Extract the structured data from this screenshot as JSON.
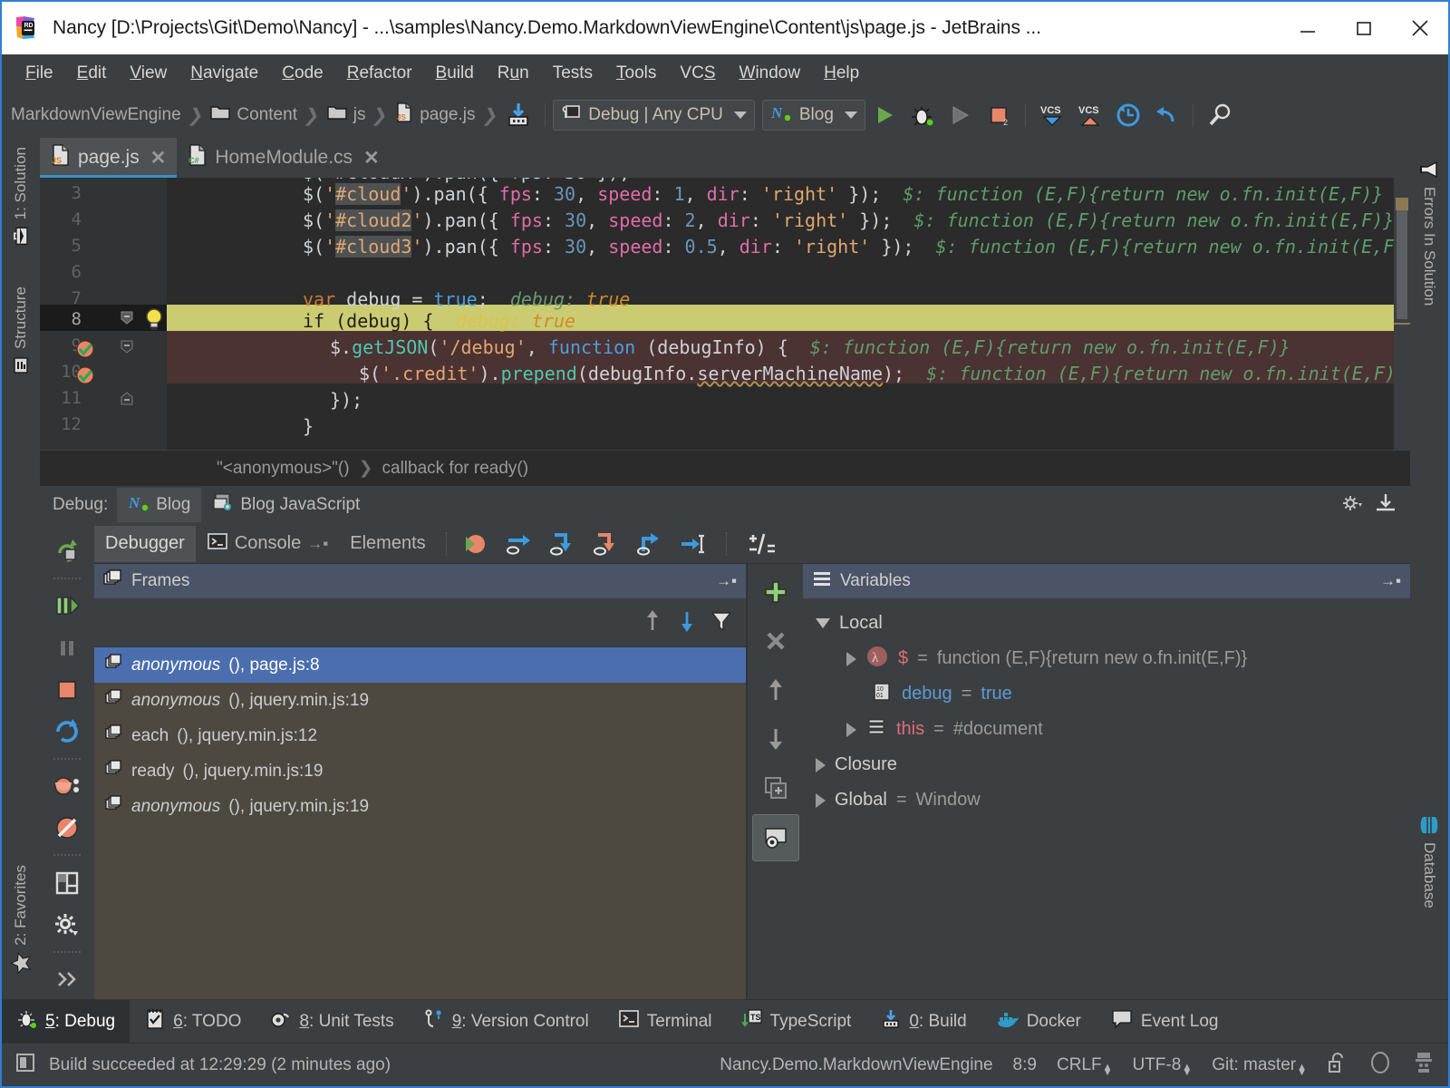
{
  "window": {
    "title": "Nancy [D:\\Projects\\Git\\Demo\\Nancy] - ...\\samples\\Nancy.Demo.MarkdownViewEngine\\Content\\js\\page.js - JetBrains ...",
    "minimize_label": "Minimize",
    "maximize_label": "Maximize",
    "close_label": "Close"
  },
  "menu": [
    {
      "label": "File",
      "mnemonic": "F"
    },
    {
      "label": "Edit",
      "mnemonic": "E"
    },
    {
      "label": "View",
      "mnemonic": "V"
    },
    {
      "label": "Navigate",
      "mnemonic": "N"
    },
    {
      "label": "Code",
      "mnemonic": "C"
    },
    {
      "label": "Refactor",
      "mnemonic": "R"
    },
    {
      "label": "Build",
      "mnemonic": "B"
    },
    {
      "label": "Run",
      "mnemonic": "u"
    },
    {
      "label": "Tests",
      "mnemonic": ""
    },
    {
      "label": "Tools",
      "mnemonic": "T"
    },
    {
      "label": "VCS",
      "mnemonic": "S"
    },
    {
      "label": "Window",
      "mnemonic": "W"
    },
    {
      "label": "Help",
      "mnemonic": "H"
    }
  ],
  "toolbar": {
    "breadcrumbs": [
      {
        "label": "MarkdownViewEngine",
        "icon": "none"
      },
      {
        "label": "Content",
        "icon": "folder-icon"
      },
      {
        "label": "js",
        "icon": "folder-icon"
      },
      {
        "label": "page.js",
        "icon": "js-file-icon"
      }
    ],
    "build_icon": "build-icon",
    "config_combo": "Debug | Any CPU",
    "run_combo": "Blog",
    "run_button": "run-button",
    "debug_button": "debug-button",
    "coverage_button": "coverage-button",
    "stop_button": "stop-button",
    "vcs_update_label": "VCS",
    "vcs_commit_label": "VCS",
    "rollback_button": "rollback-button",
    "undo_button": "undo-button",
    "search_button": "search-everywhere-button"
  },
  "left_sidebar": [
    {
      "label": "1: Solution",
      "mnemonic": "1",
      "icon": "solution-icon"
    },
    {
      "label": "Structure",
      "mnemonic": "",
      "icon": "structure-icon"
    },
    {
      "label": "2: Favorites",
      "mnemonic": "2",
      "icon": "star-icon"
    }
  ],
  "right_sidebar": [
    {
      "label": "Errors In Solution",
      "icon": "flask-icon"
    },
    {
      "label": "Database",
      "icon": "database-icon"
    }
  ],
  "editor": {
    "tabs": [
      {
        "label": "page.js",
        "icon": "js-file-icon",
        "active": true,
        "close": "✕"
      },
      {
        "label": "HomeModule.cs",
        "icon": "cs-file-icon",
        "active": false,
        "close": "✕"
      }
    ],
    "line_numbers": [
      "3",
      "4",
      "5",
      "6",
      "7",
      "8",
      "9",
      "10",
      "11",
      "12"
    ],
    "current_line": "8",
    "lines": [
      {
        "num": "3",
        "tokens": [
          {
            "t": "$(",
            "c": "punc"
          },
          {
            "t": "'",
            "c": "str"
          },
          {
            "t": "#cloud",
            "c": "str sel"
          },
          {
            "t": "'",
            "c": "str"
          },
          {
            "t": ").",
            "c": "punc"
          },
          {
            "t": "pan",
            "c": "id"
          },
          {
            "t": "({ ",
            "c": "punc"
          },
          {
            "t": "fps",
            "c": "prop"
          },
          {
            "t": ": ",
            "c": "punc"
          },
          {
            "t": "30",
            "c": "num"
          },
          {
            "t": ", ",
            "c": "punc"
          },
          {
            "t": "speed",
            "c": "prop"
          },
          {
            "t": ": ",
            "c": "punc"
          },
          {
            "t": "1",
            "c": "num"
          },
          {
            "t": ", ",
            "c": "punc"
          },
          {
            "t": "dir",
            "c": "prop"
          },
          {
            "t": ": ",
            "c": "punc"
          },
          {
            "t": "'right'",
            "c": "str"
          },
          {
            "t": " });",
            "c": "punc"
          }
        ],
        "hint": "$: function (E,F){return new o.fn.init(E,F)}"
      },
      {
        "num": "4",
        "tokens": [
          {
            "t": "$(",
            "c": "punc"
          },
          {
            "t": "'",
            "c": "str"
          },
          {
            "t": "#cloud2",
            "c": "str sel"
          },
          {
            "t": "'",
            "c": "str"
          },
          {
            "t": ").",
            "c": "punc"
          },
          {
            "t": "pan",
            "c": "id"
          },
          {
            "t": "({ ",
            "c": "punc"
          },
          {
            "t": "fps",
            "c": "prop"
          },
          {
            "t": ": ",
            "c": "punc"
          },
          {
            "t": "30",
            "c": "num"
          },
          {
            "t": ", ",
            "c": "punc"
          },
          {
            "t": "speed",
            "c": "prop"
          },
          {
            "t": ": ",
            "c": "punc"
          },
          {
            "t": "2",
            "c": "num"
          },
          {
            "t": ", ",
            "c": "punc"
          },
          {
            "t": "dir",
            "c": "prop"
          },
          {
            "t": ": ",
            "c": "punc"
          },
          {
            "t": "'right'",
            "c": "str"
          },
          {
            "t": " });",
            "c": "punc"
          }
        ],
        "hint": "$: function (E,F){return new o.fn.init(E,F)}"
      },
      {
        "num": "5",
        "tokens": [
          {
            "t": "$(",
            "c": "punc"
          },
          {
            "t": "'",
            "c": "str"
          },
          {
            "t": "#cloud3",
            "c": "str sel"
          },
          {
            "t": "'",
            "c": "str"
          },
          {
            "t": ").",
            "c": "punc"
          },
          {
            "t": "pan",
            "c": "id"
          },
          {
            "t": "({ ",
            "c": "punc"
          },
          {
            "t": "fps",
            "c": "prop"
          },
          {
            "t": ": ",
            "c": "punc"
          },
          {
            "t": "30",
            "c": "num"
          },
          {
            "t": ", ",
            "c": "punc"
          },
          {
            "t": "speed",
            "c": "prop"
          },
          {
            "t": ": ",
            "c": "punc"
          },
          {
            "t": "0.5",
            "c": "num"
          },
          {
            "t": ", ",
            "c": "punc"
          },
          {
            "t": "dir",
            "c": "prop"
          },
          {
            "t": ": ",
            "c": "punc"
          },
          {
            "t": "'right'",
            "c": "str"
          },
          {
            "t": " });",
            "c": "punc"
          }
        ],
        "hint": "$: function (E,F){return new o.fn.init(E,F)}"
      },
      {
        "num": "6",
        "tokens": [],
        "hint": ""
      },
      {
        "num": "7",
        "tokens": [
          {
            "t": "var ",
            "c": "kw"
          },
          {
            "t": "debug",
            "c": "id"
          },
          {
            "t": " = ",
            "c": "punc"
          },
          {
            "t": "true",
            "c": "kw2"
          },
          {
            "t": ";",
            "c": "punc"
          }
        ],
        "hint": "",
        "inline_debug": {
          "name": "debug:",
          "value": "true",
          "style": "normal"
        }
      },
      {
        "num": "8",
        "tokens": [
          {
            "t": "if ",
            "c": "dark"
          },
          {
            "t": "(debug) {",
            "c": "dark"
          }
        ],
        "hint": "",
        "inline_debug": {
          "name": "debug:",
          "value": "true",
          "style": "highlight"
        }
      },
      {
        "num": "9",
        "tokens": [
          {
            "t": "$.",
            "c": "punc"
          },
          {
            "t": "getJSON",
            "c": "fnc"
          },
          {
            "t": "(",
            "c": "punc"
          },
          {
            "t": "'/debug'",
            "c": "str"
          },
          {
            "t": ", ",
            "c": "punc"
          },
          {
            "t": "function ",
            "c": "kw2"
          },
          {
            "t": "(debugInfo) {",
            "c": "punc"
          }
        ],
        "hint": "$: function (E,F){return new o.fn.init(E,F)}"
      },
      {
        "num": "10",
        "tokens": [
          {
            "t": "$(",
            "c": "punc"
          },
          {
            "t": "'.credit'",
            "c": "str"
          },
          {
            "t": ").",
            "c": "punc"
          },
          {
            "t": "prepend",
            "c": "fnc"
          },
          {
            "t": "(debugInfo.",
            "c": "punc"
          },
          {
            "t": "serverMachineName",
            "c": "wavy"
          },
          {
            "t": ");",
            "c": "punc"
          }
        ],
        "hint": "$: function (E,F){return new o.fn.init(E,F)}"
      },
      {
        "num": "11",
        "tokens": [
          {
            "t": "});",
            "c": "punc"
          }
        ],
        "hint": ""
      },
      {
        "num": "12",
        "tokens": [
          {
            "t": "}",
            "c": "punc"
          }
        ],
        "hint": ""
      }
    ],
    "breadcrumb": [
      "\"<anonymous>\"()",
      "callback for ready()"
    ],
    "gutter_icons": {
      "line8": "intention-bulb-icon",
      "line9": "breakpoint-verified-icon",
      "line10": "breakpoint-verified-icon"
    }
  },
  "debug": {
    "label": "Debug:",
    "session_tabs": [
      {
        "label": "Blog",
        "icon": "nancy-icon",
        "selected": true
      },
      {
        "label": "Blog JavaScript",
        "icon": "js-debug-icon",
        "selected": false
      }
    ],
    "settings_icon": "settings-gear-icon",
    "export_icon": "export-icon",
    "tabs": [
      {
        "label": "Debugger",
        "icon": "",
        "selected": true
      },
      {
        "label": "Console",
        "icon": "console-icon",
        "selected": false
      },
      {
        "label": "Elements",
        "icon": "",
        "selected": false
      }
    ],
    "left_buttons": [
      {
        "name": "rerun-button",
        "icon": "rerun-icon"
      },
      {
        "name": "resume-program-button",
        "icon": "resume-icon"
      },
      {
        "name": "pause-program-button",
        "icon": "pause-icon"
      },
      {
        "name": "stop-button",
        "icon": "stop-icon"
      },
      {
        "name": "restart-button",
        "icon": "restart-icon"
      },
      {
        "name": "view-breakpoints-button",
        "icon": "breakpoints-icon"
      },
      {
        "name": "mute-breakpoints-button",
        "icon": "mute-breakpoints-icon"
      },
      {
        "name": "layout-settings-button",
        "icon": "layout-icon"
      },
      {
        "name": "settings-button",
        "icon": "gear-icon"
      },
      {
        "name": "more-button",
        "icon": "chevron-double-right-icon"
      }
    ],
    "step_buttons": [
      {
        "name": "show-execution-point-button",
        "icon": "execution-point-icon"
      },
      {
        "name": "step-over-button",
        "icon": "step-over-icon"
      },
      {
        "name": "step-into-button",
        "icon": "step-into-icon"
      },
      {
        "name": "force-step-into-button",
        "icon": "force-step-into-icon"
      },
      {
        "name": "step-out-button",
        "icon": "step-out-icon"
      },
      {
        "name": "run-to-cursor-button",
        "icon": "run-to-cursor-icon"
      },
      {
        "name": "evaluate-expression-button",
        "icon": "evaluate-icon"
      }
    ],
    "frames": {
      "title": "Frames",
      "settings_icon": "move-to-icon",
      "toolbar": [
        {
          "name": "frames-up-button",
          "icon": "arrow-up-icon"
        },
        {
          "name": "frames-down-button",
          "icon": "arrow-down-icon"
        },
        {
          "name": "frames-filter-button",
          "icon": "filter-icon"
        }
      ],
      "items": [
        {
          "fn": "anonymous",
          "italic": true,
          "location": "(), page.js:8",
          "selected": true
        },
        {
          "fn": "anonymous",
          "italic": true,
          "location": "(), jquery.min.js:19",
          "selected": false
        },
        {
          "fn": "each",
          "italic": false,
          "location": "(), jquery.min.js:12",
          "selected": false
        },
        {
          "fn": "ready",
          "italic": false,
          "location": "(), jquery.min.js:19",
          "selected": false
        },
        {
          "fn": "anonymous",
          "italic": true,
          "location": "(), jquery.min.js:19",
          "selected": false
        }
      ]
    },
    "variables": {
      "title": "Variables",
      "settings_icon": "move-to-icon",
      "side_buttons": [
        {
          "name": "add-watch-button",
          "icon": "plus-icon"
        },
        {
          "name": "remove-watch-button",
          "icon": "x-icon"
        },
        {
          "name": "move-watch-up-button",
          "icon": "arrow-up-icon"
        },
        {
          "name": "move-watch-down-button",
          "icon": "arrow-down-icon"
        },
        {
          "name": "copy-watch-button",
          "icon": "copy-icon"
        },
        {
          "name": "inspect-button",
          "icon": "inspect-icon"
        }
      ],
      "rows": [
        {
          "indent": 0,
          "expander": "down",
          "icon": "",
          "name": "Local",
          "eq": "",
          "value": "",
          "name_color": "plain"
        },
        {
          "indent": 1,
          "expander": "right",
          "icon": "lambda-icon",
          "name": "$",
          "eq": "=",
          "value": "function (E,F){return new o.fn.init(E,F)}",
          "name_color": "red"
        },
        {
          "indent": 1,
          "expander": "none",
          "icon": "primitive-icon",
          "name": "debug",
          "eq": "=",
          "value": "true",
          "name_color": "blue",
          "value_color": "blue"
        },
        {
          "indent": 1,
          "expander": "right",
          "icon": "object-icon",
          "name": "this",
          "eq": "=",
          "value": "#document",
          "name_color": "red"
        },
        {
          "indent": 0,
          "expander": "right",
          "icon": "",
          "name": "Closure",
          "eq": "",
          "value": "",
          "name_color": "plain"
        },
        {
          "indent": 0,
          "expander": "right",
          "icon": "",
          "name": "Global",
          "eq": "=",
          "value": "Window",
          "name_color": "plain"
        }
      ]
    }
  },
  "tool_tabs": [
    {
      "label": "5: Debug",
      "mnemonic": "5",
      "icon": "debug-icon",
      "selected": true
    },
    {
      "label": "6: TODO",
      "mnemonic": "6",
      "icon": "todo-icon",
      "selected": false
    },
    {
      "label": "8: Unit Tests",
      "mnemonic": "8",
      "icon": "unit-tests-icon",
      "selected": false
    },
    {
      "label": "9: Version Control",
      "mnemonic": "9",
      "icon": "vcs-icon",
      "selected": false
    },
    {
      "label": "Terminal",
      "mnemonic": "",
      "icon": "terminal-icon",
      "selected": false
    },
    {
      "label": "TypeScript",
      "mnemonic": "",
      "icon": "typescript-icon",
      "selected": false
    },
    {
      "label": "0: Build",
      "mnemonic": "0",
      "icon": "build-icon",
      "selected": false
    },
    {
      "label": "Docker",
      "mnemonic": "",
      "icon": "docker-icon",
      "selected": false
    },
    {
      "label": "Event Log",
      "mnemonic": "",
      "icon": "event-log-icon",
      "selected": false
    }
  ],
  "status": {
    "icon": "status-icon",
    "message": "Build succeeded at 12:29:29 (2 minutes ago)",
    "project": "Nancy.Demo.MarkdownViewEngine",
    "caret": "8:9",
    "line_sep": "CRLF",
    "encoding": "UTF-8",
    "git_branch": "Git: master",
    "lock_icon": "unlocked-icon",
    "progress_icon": "progress-icon",
    "inspector_icon": "inspector-icon"
  },
  "colors": {
    "accent_blue": "#2d7fd3",
    "selection_blue": "#4b6eaf",
    "exec_line_yellow": "#cbcb72",
    "panel_bg": "#3c3f41",
    "editor_bg": "#2b2b2b",
    "green": "#6aa84f",
    "orange": "#e8866b"
  }
}
